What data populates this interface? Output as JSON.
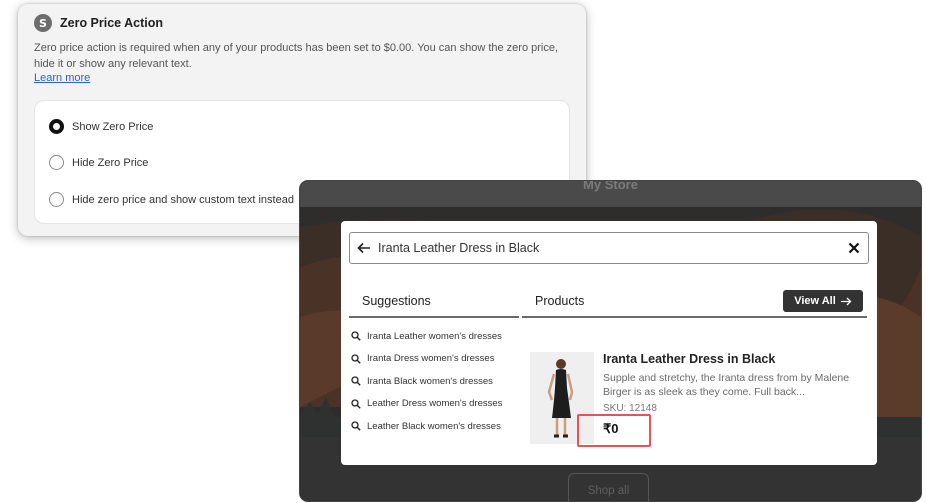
{
  "settings": {
    "app_badge_letter": "S",
    "title": "Zero Price Action",
    "description": "Zero price action is required when any of your products has been set to $0.00. You can show the zero price, hide it or show any relevant text.",
    "learn_more": "Learn more",
    "options": [
      {
        "label": "Show Zero Price",
        "selected": true
      },
      {
        "label": "Hide Zero Price",
        "selected": false
      },
      {
        "label": "Hide zero price and show custom text instead",
        "selected": false
      }
    ]
  },
  "store": {
    "name": "My Store",
    "shop_all": "Shop all"
  },
  "search": {
    "back_icon": "arrow-left-icon",
    "query": "Iranta Leather Dress in Black",
    "close_icon": "close-icon",
    "suggestions_heading": "Suggestions",
    "products_heading": "Products",
    "view_all": "View All",
    "view_all_icon": "arrow-right-icon",
    "suggestions": [
      "Iranta Leather women's dresses",
      "Iranta Dress women's dresses",
      "Iranta Black women's dresses",
      "Leather Dress women's dresses",
      "Leather Black women's dresses"
    ],
    "product": {
      "title": "Iranta Leather Dress in Black",
      "description": "Supple and stretchy, the Iranta dress from by Malene Birger is as sleek as they come. Full back...",
      "sku": "SKU: 12148",
      "price": "₹0"
    }
  },
  "colors": {
    "highlight": "#e0565b",
    "link": "#2b63c9",
    "button_dark": "#333333"
  }
}
